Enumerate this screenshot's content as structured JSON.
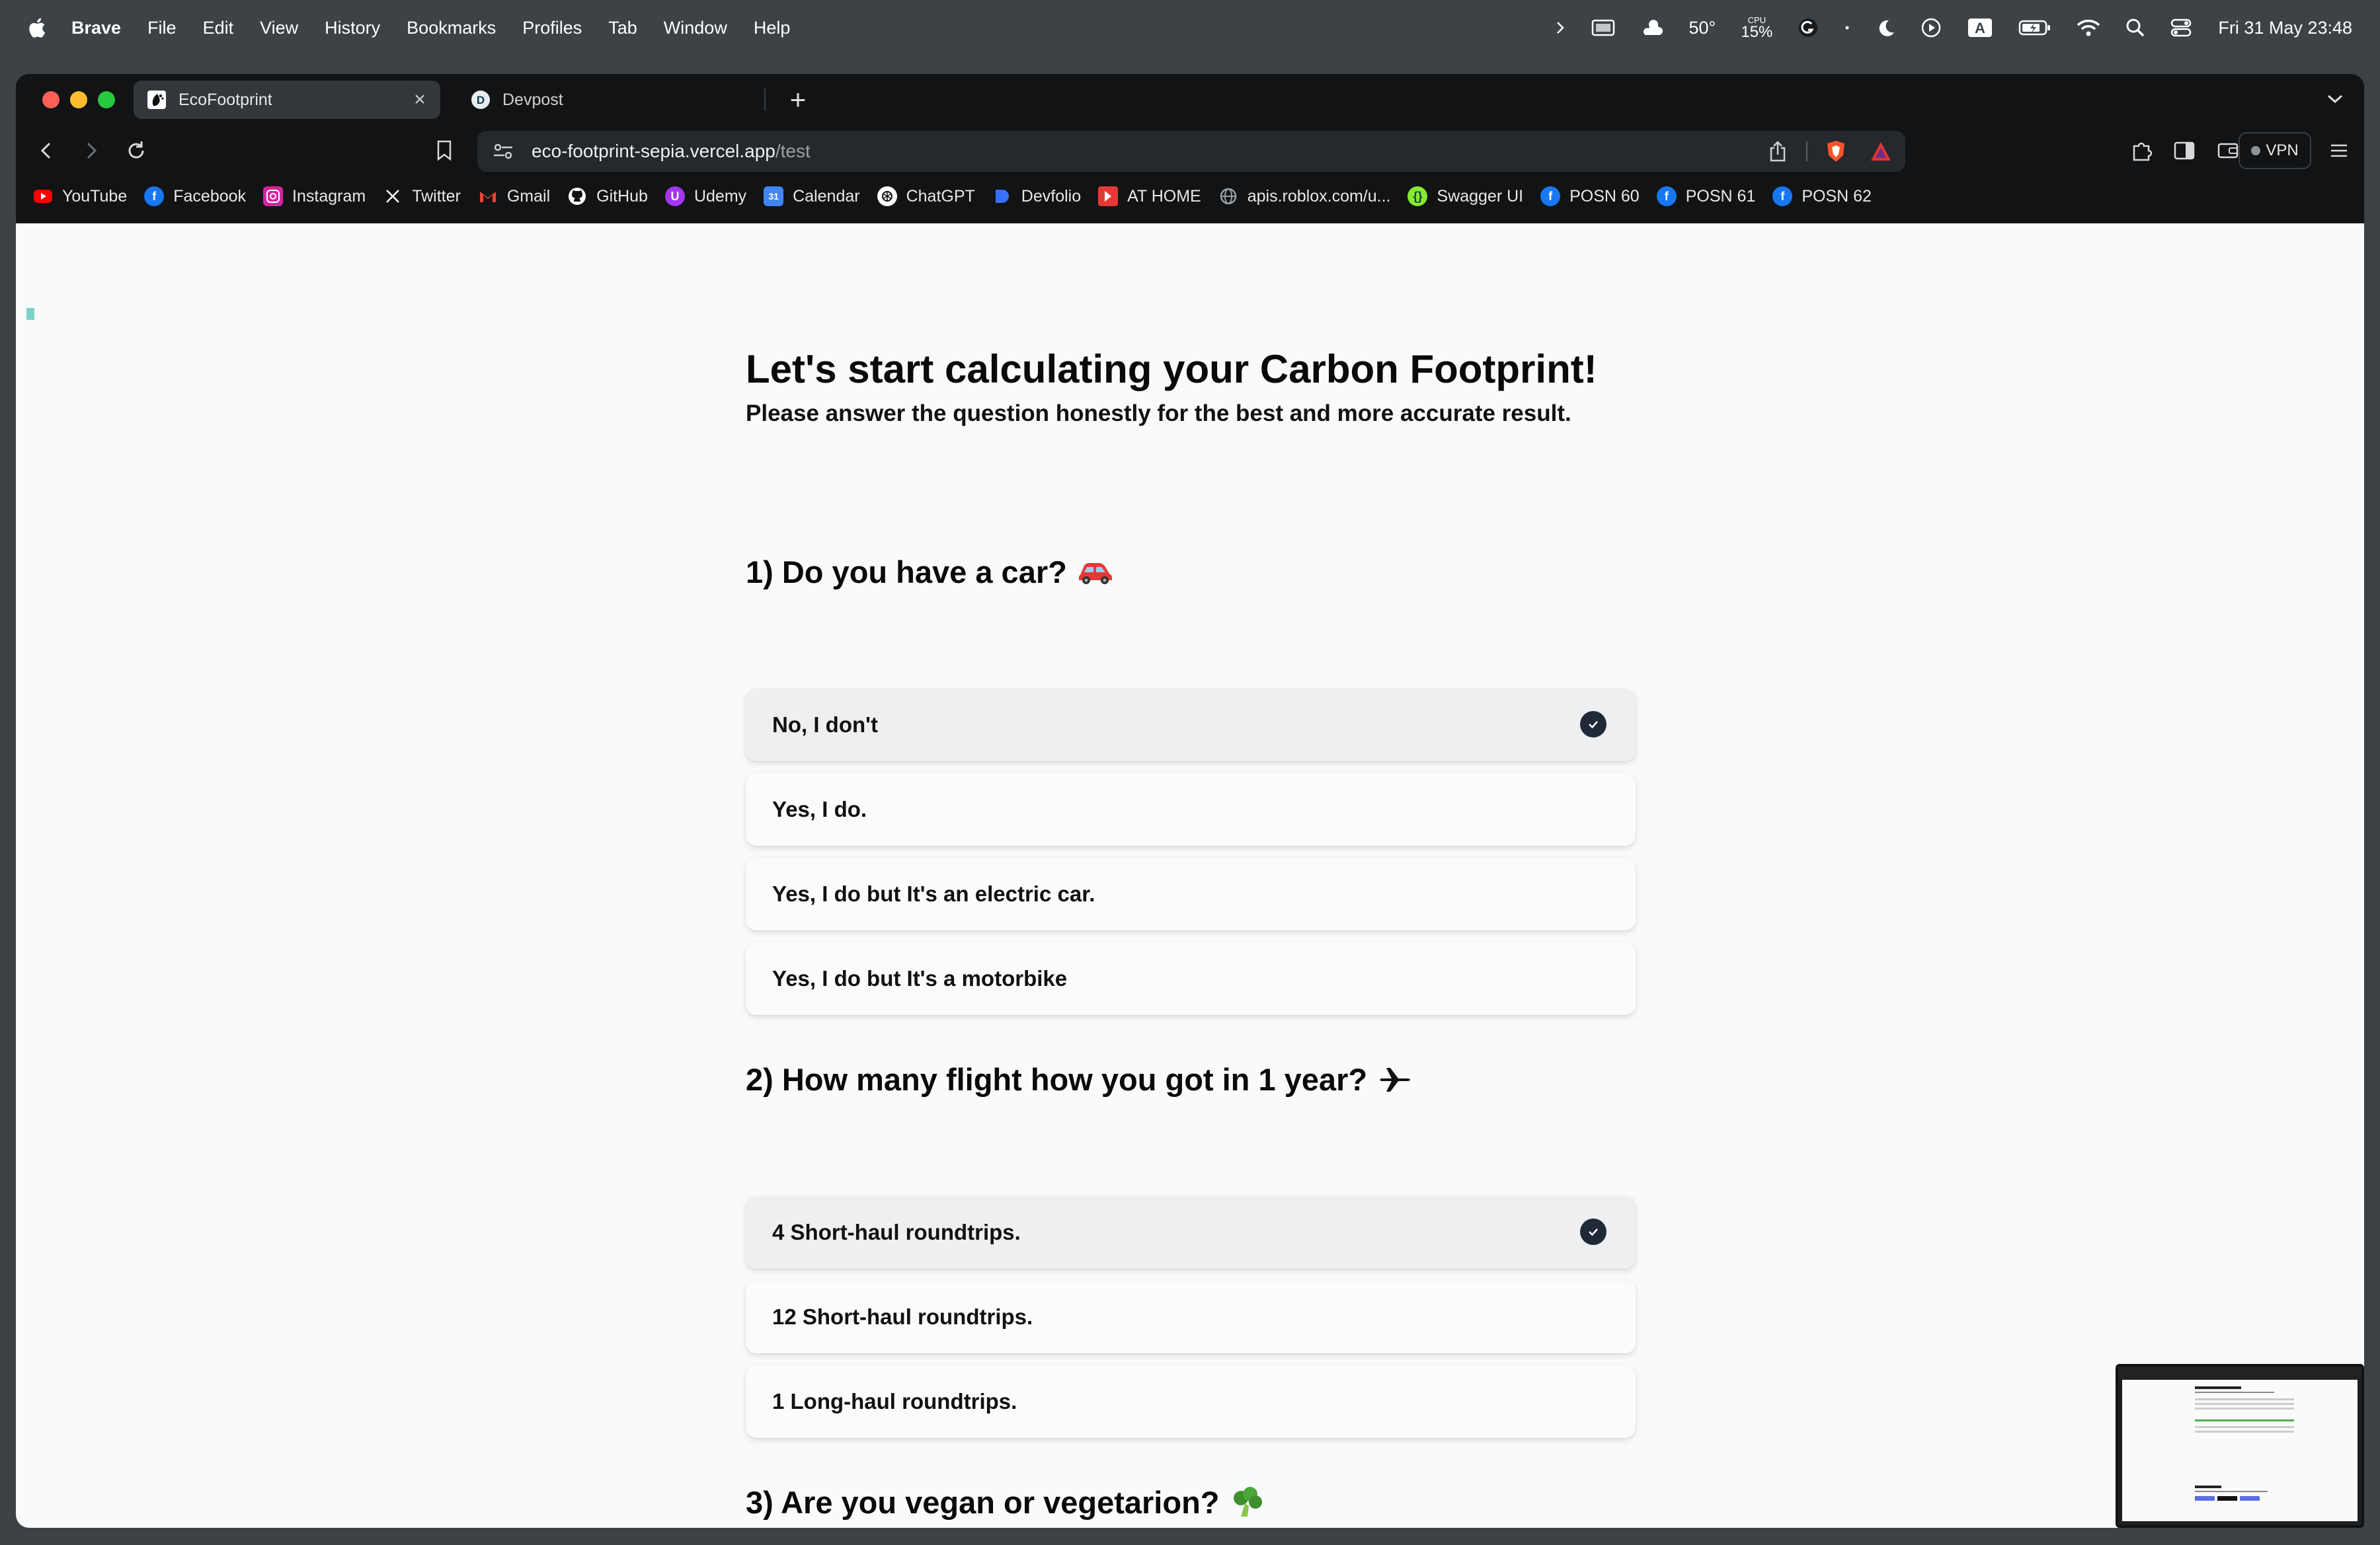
{
  "menubar": {
    "app_name": "Brave",
    "items": [
      "File",
      "Edit",
      "View",
      "History",
      "Bookmarks",
      "Profiles",
      "Tab",
      "Window",
      "Help"
    ],
    "temperature": "50°",
    "cpu_label": "CPU",
    "cpu_value": "15%",
    "keyboard_letter": "A",
    "datetime": "Fri 31 May  23:48"
  },
  "browser": {
    "tabs": [
      {
        "title": "EcoFootprint",
        "favicon": "ecofootprint-icon",
        "active": true
      },
      {
        "title": "Devpost",
        "favicon": "devpost-icon",
        "favicon_letter": "D",
        "active": false
      }
    ],
    "url_host": "eco-footprint-sepia.vercel.app",
    "url_path": "/test",
    "vpn_label": "VPN",
    "bookmarks": [
      {
        "label": "YouTube",
        "icon": "youtube-icon",
        "color": "#ff0000"
      },
      {
        "label": "Facebook",
        "icon": "facebook-icon",
        "color": "#1877f2"
      },
      {
        "label": "Instagram",
        "icon": "instagram-icon",
        "color": "#d6249f"
      },
      {
        "label": "Twitter",
        "icon": "x-icon",
        "color": "#000000"
      },
      {
        "label": "Gmail",
        "icon": "gmail-icon",
        "color": "#ea4335"
      },
      {
        "label": "GitHub",
        "icon": "github-icon",
        "color": "#ffffff"
      },
      {
        "label": "Udemy",
        "icon": "udemy-icon",
        "color": "#a435f0"
      },
      {
        "label": "Calendar",
        "icon": "calendar-icon",
        "color": "#4285f4"
      },
      {
        "label": "ChatGPT",
        "icon": "chatgpt-icon",
        "color": "#ffffff"
      },
      {
        "label": "Devfolio",
        "icon": "devfolio-icon",
        "color": "#3770ff"
      },
      {
        "label": "AT HOME",
        "icon": "athome-icon",
        "color": "#e53935"
      },
      {
        "label": "apis.roblox.com/u...",
        "icon": "globe-icon",
        "color": "#9aa0a6"
      },
      {
        "label": "Swagger UI",
        "icon": "swagger-icon",
        "color": "#85ea2d"
      },
      {
        "label": "POSN 60",
        "icon": "facebook-icon",
        "color": "#1877f2"
      },
      {
        "label": "POSN 61",
        "icon": "facebook-icon",
        "color": "#1877f2"
      },
      {
        "label": "POSN 62",
        "icon": "facebook-icon",
        "color": "#1877f2"
      }
    ]
  },
  "page": {
    "title": "Let's start calculating your Carbon Footprint!",
    "subtitle": "Please answer the question honestly for the best and more accurate result.",
    "questions": [
      {
        "text": "1) Do you have a car?",
        "icon": "car-icon",
        "options": [
          {
            "label": "No, I don't",
            "selected": true
          },
          {
            "label": "Yes, I do.",
            "selected": false
          },
          {
            "label": "Yes, I do but It's an electric car.",
            "selected": false
          },
          {
            "label": "Yes, I do but It's a motorbike",
            "selected": false
          }
        ]
      },
      {
        "text": "2) How many flight how you got in 1 year?",
        "icon": "airplane-icon",
        "options": [
          {
            "label": "4 Short-haul roundtrips.",
            "selected": true
          },
          {
            "label": "12 Short-haul roundtrips.",
            "selected": false
          },
          {
            "label": "1 Long-haul roundtrips.",
            "selected": false
          }
        ]
      },
      {
        "text": "3) Are you vegan or vegetarion?",
        "icon": "broccoli-icon",
        "options": []
      }
    ]
  },
  "colors": {
    "accent_dark": "#1f2937",
    "page_bg": "#f9fafb",
    "selected_option_bg": "#eeeff1"
  }
}
